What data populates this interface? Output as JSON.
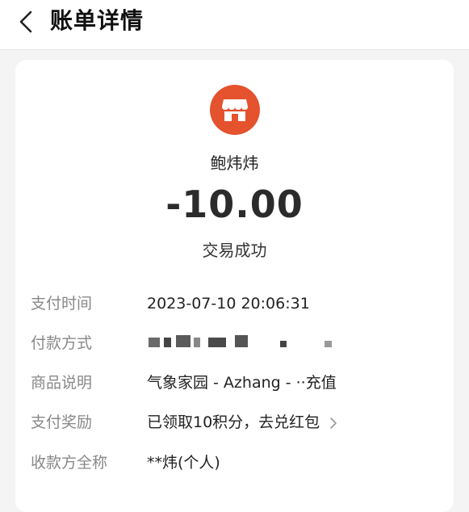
{
  "header": {
    "title": "账单详情"
  },
  "merchant": {
    "name": "鲍炜炜",
    "icon": "store-icon",
    "color": "#e4522e"
  },
  "transaction": {
    "amount": "-10.00",
    "status": "交易成功"
  },
  "details": {
    "pay_time_label": "支付时间",
    "pay_time_value": "2023-07-10 20:06:31",
    "method_label": "付款方式",
    "method_value": "",
    "goods_label": "商品说明",
    "goods_value": "气象家园 - Azhang - ··充值",
    "reward_label": "支付奖励",
    "reward_value": "已领取10积分，去兑红包",
    "payee_label": "收款方全称",
    "payee_value": "**炜(个人)"
  }
}
